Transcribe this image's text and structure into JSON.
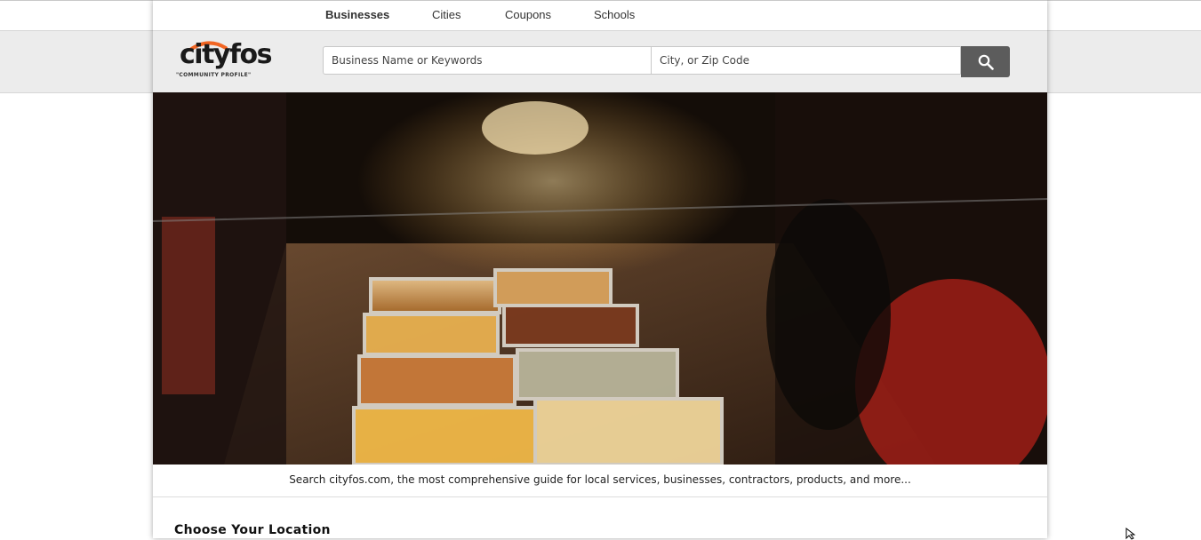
{
  "nav": {
    "items": [
      {
        "label": "Businesses",
        "active": true
      },
      {
        "label": "Cities",
        "active": false
      },
      {
        "label": "Coupons",
        "active": false
      },
      {
        "label": "Schools",
        "active": false
      }
    ]
  },
  "logo": {
    "name": "cityfos",
    "tagline": "\"COMMUNITY PROFILE\"",
    "accent_color": "#f26522"
  },
  "search": {
    "keyword_placeholder": "Business Name or Keywords",
    "location_placeholder": "City, or Zip Code",
    "button_icon": "search-icon"
  },
  "hero": {
    "caption": "Search cityfos.com, the most comprehensive guide for local services, businesses, contractors, products, and more..."
  },
  "main": {
    "section_title": "Choose Your Location"
  },
  "colors": {
    "header_bg": "#ececec",
    "search_button": "#5c5c5c",
    "logo_accent": "#f26522"
  }
}
